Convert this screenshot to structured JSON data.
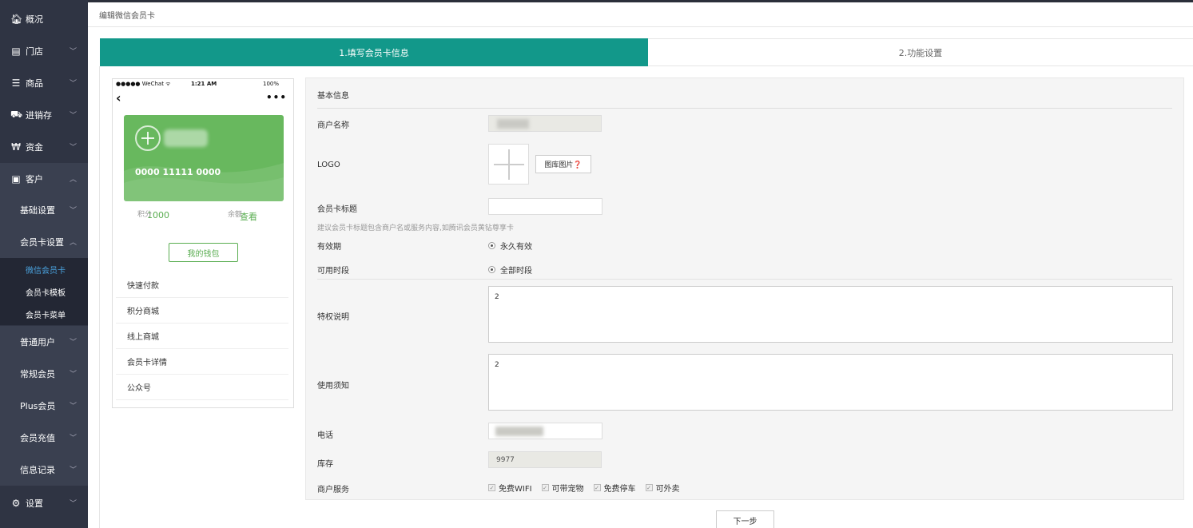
{
  "sidebar": {
    "items": [
      {
        "label": "概况",
        "icon": "home-icon"
      },
      {
        "label": "门店",
        "icon": "store-icon"
      },
      {
        "label": "商品",
        "icon": "list-icon"
      },
      {
        "label": "进销存",
        "icon": "truck-icon"
      },
      {
        "label": "资金",
        "icon": "won-icon"
      },
      {
        "label": "客户",
        "icon": "id-card-icon"
      },
      {
        "label": "基础设置"
      },
      {
        "label": "会员卡设置"
      },
      {
        "label": "微信会员卡"
      },
      {
        "label": "会员卡模板"
      },
      {
        "label": "会员卡菜单"
      },
      {
        "label": "普通用户"
      },
      {
        "label": "常规会员"
      },
      {
        "label": "Plus会员"
      },
      {
        "label": "会员充值"
      },
      {
        "label": "信息记录"
      },
      {
        "label": "设置",
        "icon": "gear-icon"
      }
    ]
  },
  "breadcrumb": "编辑微信会员卡",
  "steps": [
    "1.填写会员卡信息",
    "2.功能设置"
  ],
  "phone": {
    "carrier": "●●●●● WeChat ᯤ",
    "time": "1:21 AM",
    "battery": "100%",
    "card_number": "0000 11111 0000",
    "points_label": "积分",
    "points_value": "1000",
    "balance_label": "余额",
    "balance_value": "查看",
    "wallet_button": "我的钱包",
    "menu": [
      "快速付款",
      "积分商城",
      "线上商城",
      "会员卡详情",
      "公众号"
    ]
  },
  "form": {
    "section_title": "基本信息",
    "merchant_label": "商户名称",
    "logo_label": "LOGO",
    "library_button": "图库图片❓",
    "card_title_label": "会员卡标题",
    "card_title_value": "",
    "hint": "建议会员卡标题包含商户名或服务内容,如腾讯会员黄钻尊享卡",
    "validity_label": "有效期",
    "validity_value": "永久有效",
    "period_label": "可用时段",
    "period_value": "全部时段",
    "privilege_label": "特权说明",
    "privilege_value": "2",
    "notice_label": "使用须知",
    "notice_value": "2",
    "phone_label": "电话",
    "stock_label": "库存",
    "stock_value": "9977",
    "services_label": "商户服务",
    "services": [
      "免费WIFI",
      "可带宠物",
      "免费停车",
      "可外卖"
    ]
  },
  "next_button": "下一步",
  "colors": {
    "sidebar": "#2f3443",
    "accent": "#12988a",
    "card": "#68b85e",
    "link": "#4aa3df"
  }
}
